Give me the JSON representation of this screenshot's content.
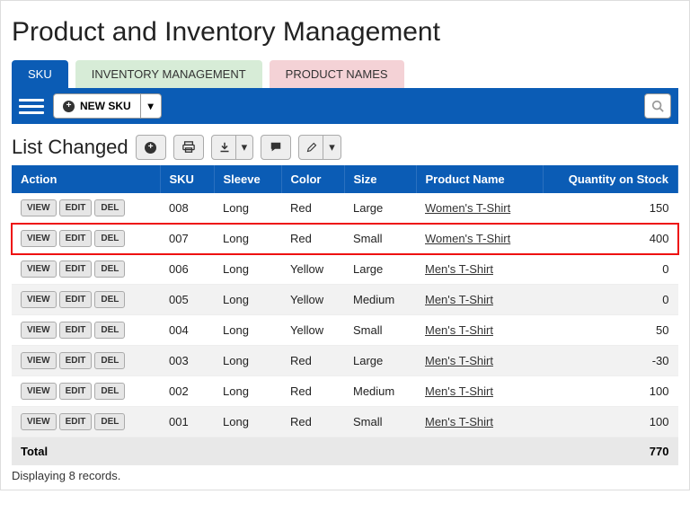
{
  "title": "Product and Inventory Management",
  "tabs": {
    "sku": "SKU",
    "inventory": "INVENTORY MANAGEMENT",
    "products": "PRODUCT NAMES"
  },
  "toolbar": {
    "new_sku": "NEW SKU"
  },
  "section": {
    "heading": "List Changed"
  },
  "columns": {
    "action": "Action",
    "sku": "SKU",
    "sleeve": "Sleeve",
    "color": "Color",
    "size": "Size",
    "product": "Product Name",
    "qty": "Quantity on Stock"
  },
  "row_labels": {
    "view": "VIEW",
    "edit": "EDIT",
    "del": "DEL"
  },
  "rows": [
    {
      "sku": "008",
      "sleeve": "Long",
      "color": "Red",
      "size": "Large",
      "product": "Women's T-Shirt",
      "qty": "150",
      "highlight": false
    },
    {
      "sku": "007",
      "sleeve": "Long",
      "color": "Red",
      "size": "Small",
      "product": "Women's T-Shirt",
      "qty": "400",
      "highlight": true
    },
    {
      "sku": "006",
      "sleeve": "Long",
      "color": "Yellow",
      "size": "Large",
      "product": "Men's T-Shirt",
      "qty": "0",
      "highlight": false
    },
    {
      "sku": "005",
      "sleeve": "Long",
      "color": "Yellow",
      "size": "Medium",
      "product": "Men's T-Shirt",
      "qty": "0",
      "highlight": false
    },
    {
      "sku": "004",
      "sleeve": "Long",
      "color": "Yellow",
      "size": "Small",
      "product": "Men's T-Shirt",
      "qty": "50",
      "highlight": false
    },
    {
      "sku": "003",
      "sleeve": "Long",
      "color": "Red",
      "size": "Large",
      "product": "Men's T-Shirt",
      "qty": "-30",
      "highlight": false
    },
    {
      "sku": "002",
      "sleeve": "Long",
      "color": "Red",
      "size": "Medium",
      "product": "Men's T-Shirt",
      "qty": "100",
      "highlight": false
    },
    {
      "sku": "001",
      "sleeve": "Long",
      "color": "Red",
      "size": "Small",
      "product": "Men's T-Shirt",
      "qty": "100",
      "highlight": false
    }
  ],
  "footer": {
    "total_label": "Total",
    "total_qty": "770"
  },
  "status": "Displaying 8 records."
}
